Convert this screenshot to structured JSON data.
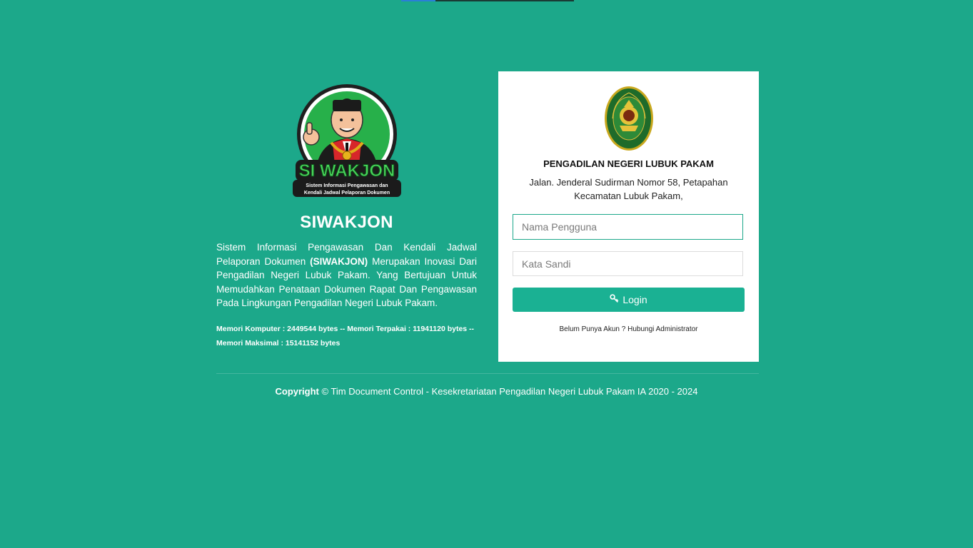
{
  "brand": {
    "app_title": "SIWAKJON",
    "logo_text": "SI WAKJON",
    "logo_subtext": "Sistem Informasi Pengawasan dan Kendali Jadwal Pelaporan Dokumen",
    "description_part1": "Sistem Informasi Pengawasan Dan Kendali Jadwal Pelaporan Dokumen ",
    "description_bold": "(SIWAKJON)",
    "description_part2": " Merupakan Inovasi Dari Pengadilan Negeri Lubuk Pakam. Yang Bertujuan Untuk Memudahkan Penataan Dokumen Rapat Dan Pengawasan Pada Lingkungan Pengadilan Negeri Lubuk Pakam.",
    "memory_line1": "Memori Komputer : 2449544 bytes -- Memori Terpakai : 11941120 bytes --",
    "memory_line2": "Memori Maksimal : 15141152 bytes"
  },
  "login_card": {
    "court_name": "PENGADILAN NEGERI LUBUK PAKAM",
    "address_line1": "Jalan. Jenderal Sudirman Nomor 58, Petapahan",
    "address_line2": "Kecamatan Lubuk Pakam,",
    "username_placeholder": "Nama Pengguna",
    "password_placeholder": "Kata Sandi",
    "login_label": "Login",
    "signup_text": "Belum Punya Akun ? Hubungi Administrator"
  },
  "footer": {
    "copyright_bold": "Copyright",
    "copyright_rest": " © Tim Document Control - Kesekretariatan Pengadilan Negeri Lubuk Pakam IA 2020 - 2024"
  },
  "colors": {
    "background": "#1ca88a",
    "button": "#1ab193",
    "card": "#ffffff"
  },
  "icons": {
    "login_icon": "key-icon",
    "mascot": "mascot-logo",
    "seal": "court-seal-logo"
  }
}
